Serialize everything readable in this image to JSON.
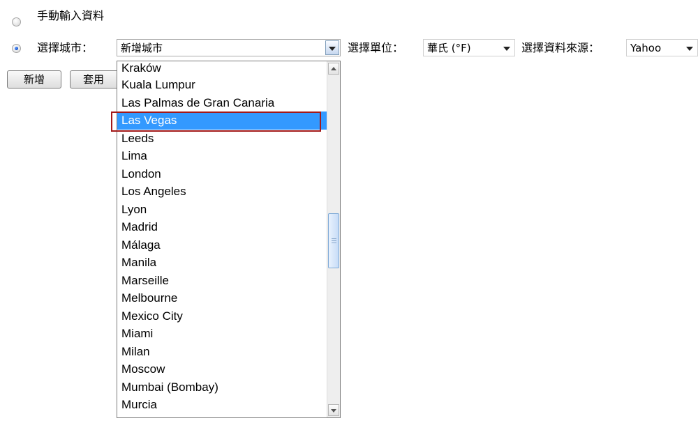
{
  "form": {
    "manual_label": "手動輸入資料",
    "city_label": "選擇城市：",
    "city_select_value": "新增城市",
    "unit_label": "選擇單位：",
    "unit_value": "華氏 (°F)",
    "source_label": "選擇資料來源：",
    "source_value": "Yahoo",
    "add_button": "新增",
    "apply_button": "套用"
  },
  "dropdown": {
    "items": [
      "Kraków",
      "Kuala Lumpur",
      "Las Palmas de Gran Canaria",
      "Las Vegas",
      "Leeds",
      "Lima",
      "London",
      "Los Angeles",
      "Lyon",
      "Madrid",
      "Málaga",
      "Manila",
      "Marseille",
      "Melbourne",
      "Mexico City",
      "Miami",
      "Milan",
      "Moscow",
      "Mumbai (Bombay)",
      "Murcia"
    ],
    "selected": "Las Vegas"
  },
  "colors": {
    "selection": "#3399ff",
    "highlight_frame": "#a31919"
  }
}
